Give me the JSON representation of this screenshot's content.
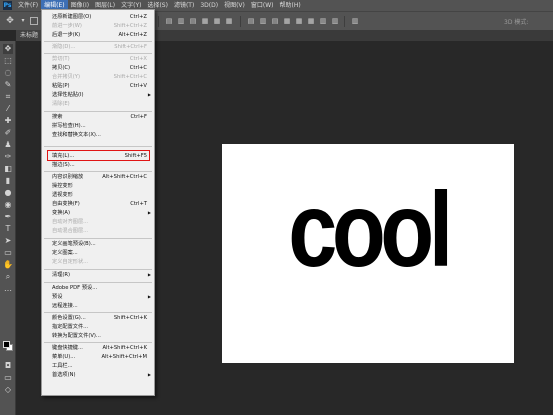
{
  "menubar": {
    "logo": "Ps",
    "items": [
      "文件(F)",
      "编辑(E)",
      "图像(I)",
      "图层(L)",
      "文字(Y)",
      "选择(S)",
      "滤镜(T)",
      "3D(D)",
      "视图(V)",
      "窗口(W)",
      "帮助(H)"
    ]
  },
  "optbar": {
    "mode_label": "3D 模式:"
  },
  "document": {
    "tab_label": "未标题"
  },
  "canvas": {
    "text": "cool",
    "background": "#ffffff",
    "text_color": "#000000"
  },
  "edit_menu": {
    "items": [
      {
        "label": "还原新建图层(O)",
        "shortcut": "Ctrl+Z",
        "disabled": false
      },
      {
        "label": "前进一步(W)",
        "shortcut": "Shift+Ctrl+Z",
        "disabled": true
      },
      {
        "label": "后退一步(K)",
        "shortcut": "Alt+Ctrl+Z",
        "disabled": false
      },
      {
        "label": "渐隐(D)...",
        "shortcut": "Shift+Ctrl+F",
        "disabled": true
      },
      {
        "label": "剪切(T)",
        "shortcut": "Ctrl+X",
        "disabled": true
      },
      {
        "label": "拷贝(C)",
        "shortcut": "Ctrl+C",
        "disabled": false
      },
      {
        "label": "合并拷贝(Y)",
        "shortcut": "Shift+Ctrl+C",
        "disabled": true
      },
      {
        "label": "粘贴(P)",
        "shortcut": "Ctrl+V",
        "disabled": false
      },
      {
        "label": "选择性粘贴(I)",
        "shortcut": "",
        "disabled": false,
        "submenu": true
      },
      {
        "label": "清除(E)",
        "shortcut": "",
        "disabled": true
      },
      {
        "label": "搜索",
        "shortcut": "Ctrl+F",
        "disabled": false
      },
      {
        "label": "拼写检查(H)...",
        "shortcut": "",
        "disabled": false
      },
      {
        "label": "查找和替换文本(X)...",
        "shortcut": "",
        "disabled": false
      },
      {
        "label": "填充(L)...",
        "shortcut": "Shift+F5",
        "disabled": false,
        "highlighted": true
      },
      {
        "label": "描边(S)...",
        "shortcut": "",
        "disabled": false
      },
      {
        "label": "内容识别缩放",
        "shortcut": "Alt+Shift+Ctrl+C",
        "disabled": false
      },
      {
        "label": "操控变形",
        "shortcut": "",
        "disabled": false
      },
      {
        "label": "透视变形",
        "shortcut": "",
        "disabled": false
      },
      {
        "label": "自由变换(F)",
        "shortcut": "Ctrl+T",
        "disabled": false
      },
      {
        "label": "变换(A)",
        "shortcut": "",
        "disabled": false,
        "submenu": true
      },
      {
        "label": "自动对齐图层...",
        "shortcut": "",
        "disabled": true
      },
      {
        "label": "自动混合图层...",
        "shortcut": "",
        "disabled": true
      },
      {
        "label": "定义画笔预设(B)...",
        "shortcut": "",
        "disabled": false
      },
      {
        "label": "定义图案...",
        "shortcut": "",
        "disabled": false
      },
      {
        "label": "定义自定形状...",
        "shortcut": "",
        "disabled": true
      },
      {
        "label": "清理(R)",
        "shortcut": "",
        "disabled": false,
        "submenu": true
      },
      {
        "label": "Adobe PDF 预设...",
        "shortcut": "",
        "disabled": false
      },
      {
        "label": "预设",
        "shortcut": "",
        "disabled": false,
        "submenu": true
      },
      {
        "label": "远程连接...",
        "shortcut": "",
        "disabled": false
      },
      {
        "label": "颜色设置(G)...",
        "shortcut": "Shift+Ctrl+K",
        "disabled": false
      },
      {
        "label": "指定配置文件...",
        "shortcut": "",
        "disabled": false
      },
      {
        "label": "转换为配置文件(V)...",
        "shortcut": "",
        "disabled": false
      },
      {
        "label": "键盘快捷键...",
        "shortcut": "Alt+Shift+Ctrl+K",
        "disabled": false
      },
      {
        "label": "菜单(U)...",
        "shortcut": "Alt+Shift+Ctrl+M",
        "disabled": false
      },
      {
        "label": "工具栏...",
        "shortcut": "",
        "disabled": false
      },
      {
        "label": "首选项(N)",
        "shortcut": "",
        "disabled": false,
        "submenu": true
      }
    ]
  },
  "colors": {
    "foreground": "#000000",
    "background": "#ffffff",
    "highlight_border": "#e01414"
  }
}
